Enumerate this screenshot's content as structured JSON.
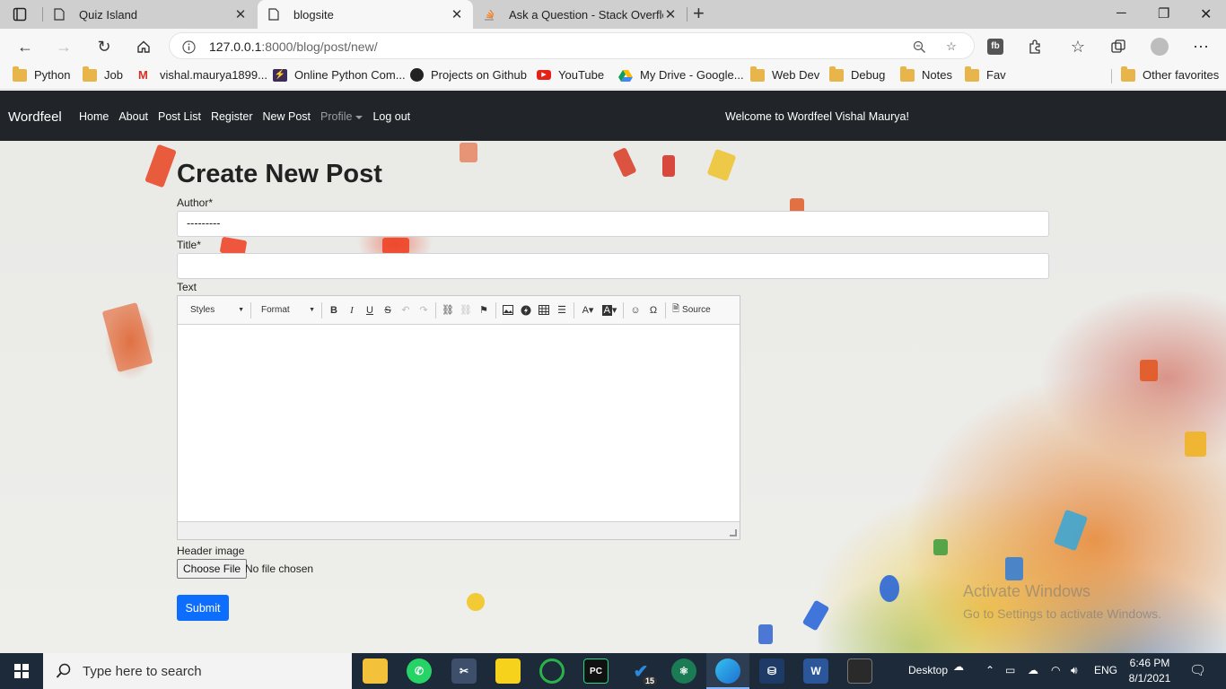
{
  "browser": {
    "tabs": [
      {
        "title": "Quiz Island",
        "active": false
      },
      {
        "title": "blogsite",
        "active": true
      },
      {
        "title": "Ask a Question - Stack Overflow",
        "active": false
      }
    ],
    "url_host": "127.0.0.1",
    "url_path": ":8000/blog/post/new/",
    "bookmarks": [
      {
        "label": "Python",
        "icon": "folder-icon"
      },
      {
        "label": "Job",
        "icon": "folder-icon"
      },
      {
        "label": "vishal.maurya1899...",
        "icon": "gmail-icon"
      },
      {
        "label": "Online Python Com...",
        "icon": "bolt-icon"
      },
      {
        "label": "Projects on Github",
        "icon": "github-icon"
      },
      {
        "label": "YouTube",
        "icon": "youtube-icon"
      },
      {
        "label": "My Drive - Google...",
        "icon": "drive-icon"
      },
      {
        "label": "Web Dev",
        "icon": "folder-icon"
      },
      {
        "label": "Debug",
        "icon": "folder-icon"
      },
      {
        "label": "Notes",
        "icon": "folder-icon"
      },
      {
        "label": "Fav",
        "icon": "folder-icon"
      }
    ],
    "other_favorites": "Other favorites"
  },
  "site": {
    "brand": "Wordfeel",
    "nav": [
      "Home",
      "About",
      "Post List",
      "Register",
      "New Post"
    ],
    "profile_label": "Profile",
    "logout_label": "Log out",
    "welcome": "Welcome to Wordfeel Vishal Maurya!"
  },
  "form": {
    "title": "Create New Post",
    "author_label": "Author*",
    "author_value": "---------",
    "title_label": "Title*",
    "title_value": "",
    "text_label": "Text",
    "editor": {
      "styles_label": "Styles",
      "format_label": "Format",
      "source_label": "Source"
    },
    "header_image_label": "Header image",
    "choose_file_label": "Choose File",
    "no_file_text": "No file chosen",
    "submit_label": "Submit"
  },
  "watermark": {
    "line1": "Activate Windows",
    "line2": "Go to Settings to activate Windows."
  },
  "taskbar": {
    "search_placeholder": "Type here to search",
    "desktop_label": "Desktop",
    "language": "ENG",
    "time": "6:46 PM",
    "date": "8/1/2021",
    "todo_badge": "15"
  }
}
